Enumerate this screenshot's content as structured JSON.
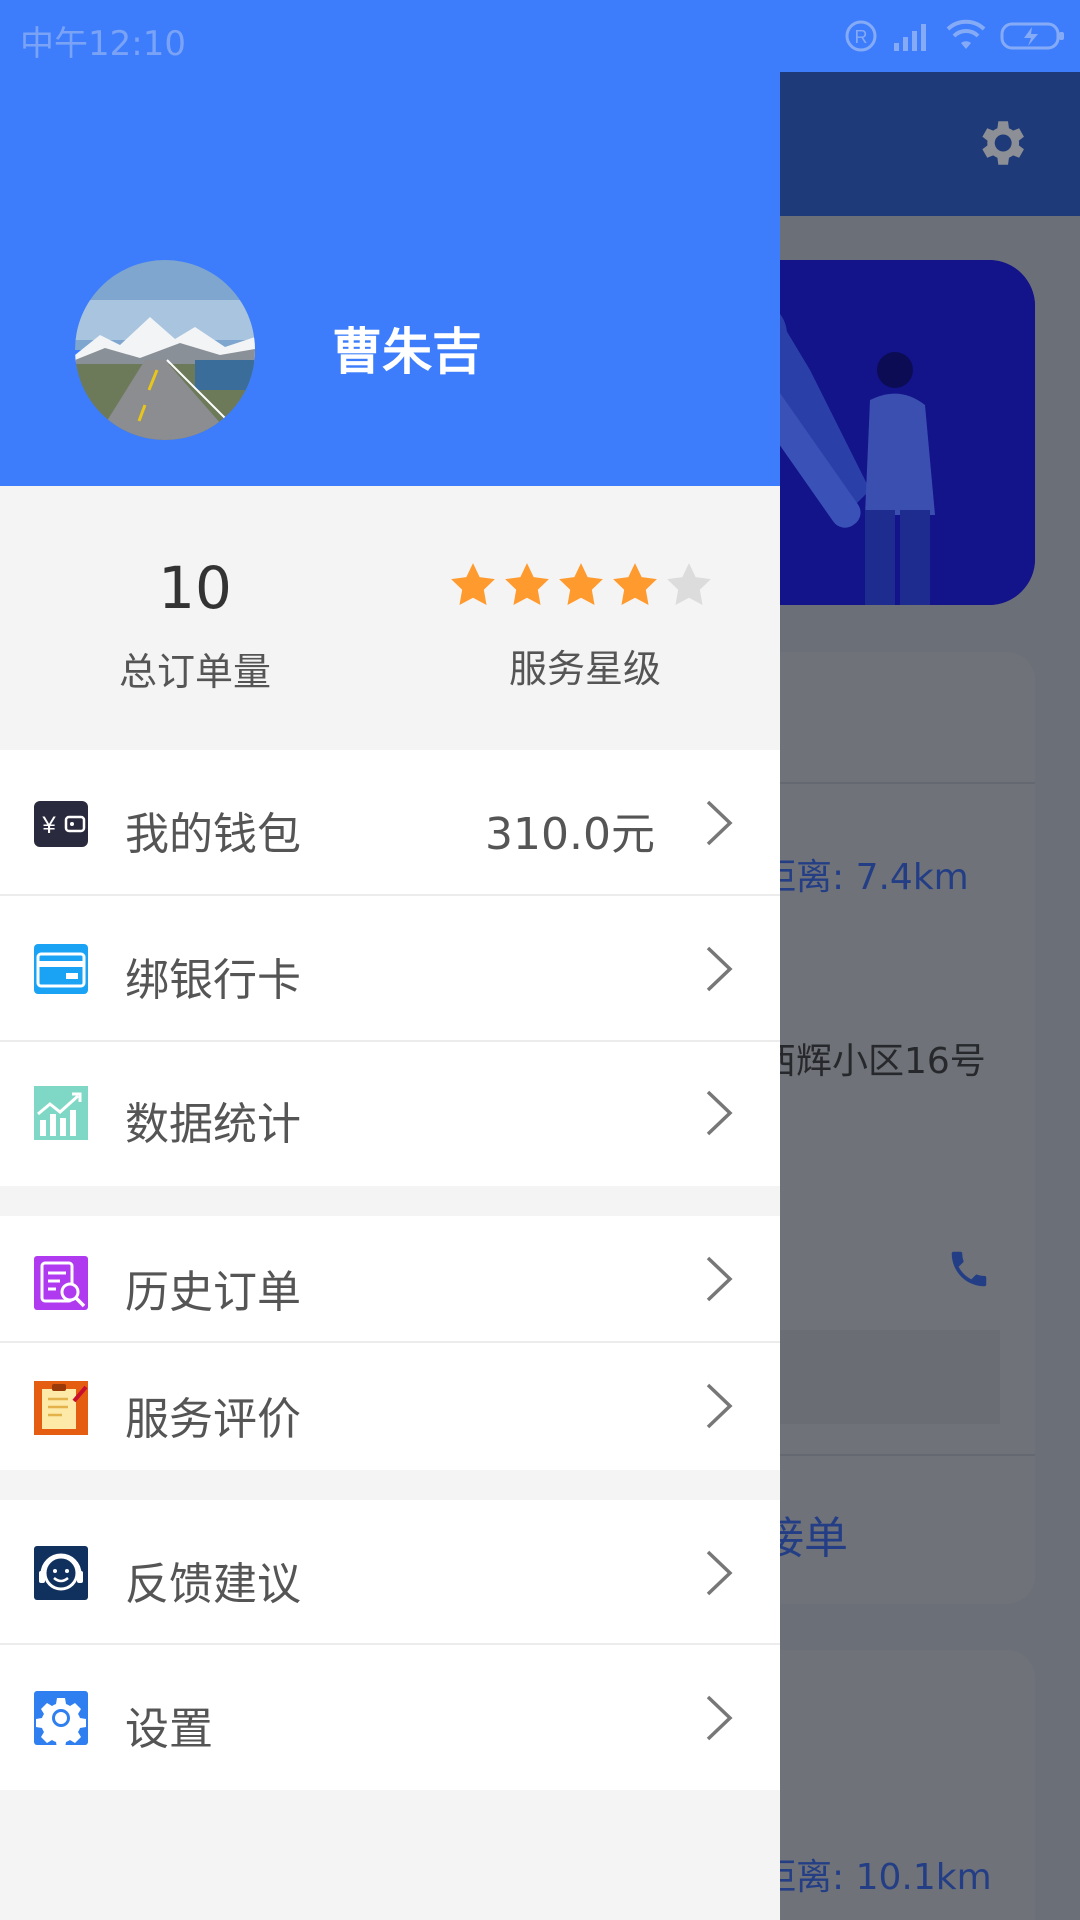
{
  "status_bar": {
    "time": "中午12:10",
    "icons": [
      "registered-icon",
      "signal-icon",
      "wifi-icon",
      "battery-charging-icon"
    ]
  },
  "user": {
    "name": "曹朱吉",
    "avatar": "road-landscape-avatar"
  },
  "stats": {
    "orders_value": "10",
    "orders_label": "总订单量",
    "rating_label": "服务星级",
    "rating_stars": 4,
    "rating_max": 5,
    "star_color": "#ff9a2e"
  },
  "menu": {
    "wallet": {
      "label": "我的钱包",
      "value": "310.0元"
    },
    "bank_card": {
      "label": "绑银行卡"
    },
    "stats": {
      "label": "数据统计"
    },
    "history": {
      "label": "历史订单"
    },
    "reviews": {
      "label": "服务评价"
    },
    "feedback": {
      "label": "反馈建议"
    },
    "settings": {
      "label": "设置"
    }
  },
  "background": {
    "distance_1": "距离: 7.4km",
    "address": "西辉小区16号",
    "accept_button": "接单",
    "distance_2": "距离: 10.1km"
  },
  "colors": {
    "header": "#3d7dfc",
    "wallet_icon": "#2a2a3e",
    "bank_icon": "#1aa3f5",
    "stats_icon": "#4fc9b0",
    "history_icon": "#b03af0",
    "reviews_icon": "#e45d10",
    "feedback_icon": "#10305e",
    "settings_icon": "#2f7ff0"
  }
}
